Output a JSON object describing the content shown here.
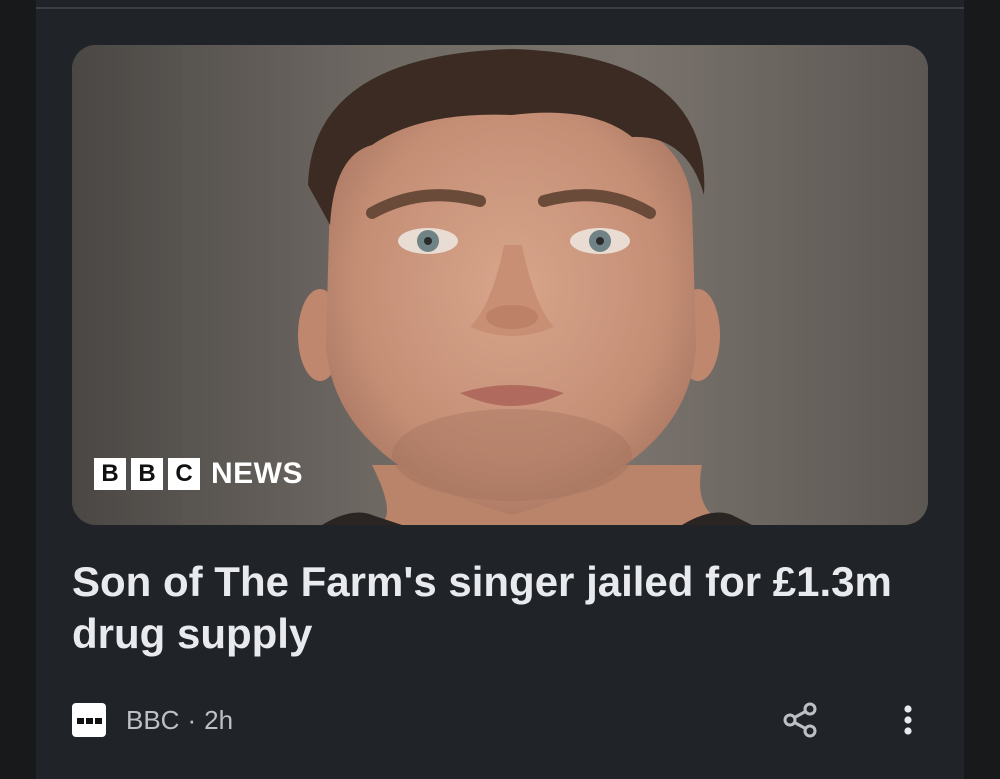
{
  "article": {
    "image_alt": "Photo of a young man",
    "logo": {
      "letters": [
        "B",
        "B",
        "C"
      ],
      "word": "NEWS"
    },
    "headline": "Son of The Farm's singer jailed for £1.3m drug supply",
    "source": "BBC",
    "separator": "·",
    "age": "2h"
  },
  "icons": {
    "source": "bbc-source-icon",
    "share": "share-icon",
    "more": "more-vert-icon"
  },
  "colors": {
    "background": "#17191b",
    "card": "#202429",
    "headline_text": "#e8eaed",
    "meta_text": "#bdc1c6"
  }
}
